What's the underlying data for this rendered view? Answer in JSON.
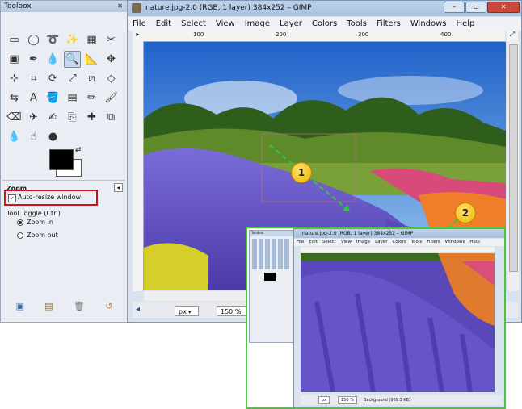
{
  "toolbox": {
    "title": "Toolbox",
    "close": "✕",
    "tools": [
      {
        "icon": "rect-select-icon",
        "glyph": "▭"
      },
      {
        "icon": "ellipse-select-icon",
        "glyph": "◯"
      },
      {
        "icon": "lasso-icon",
        "glyph": "➰"
      },
      {
        "icon": "fuzzy-select-icon",
        "glyph": "✨"
      },
      {
        "icon": "color-select-icon",
        "glyph": "▦"
      },
      {
        "icon": "scissors-select-icon",
        "glyph": "✂"
      },
      {
        "icon": "foreground-select-icon",
        "glyph": "▣"
      },
      {
        "icon": "paths-icon",
        "glyph": "✒"
      },
      {
        "icon": "color-picker-icon",
        "glyph": "💧"
      },
      {
        "icon": "zoom-icon",
        "glyph": "🔍"
      },
      {
        "icon": "measure-icon",
        "glyph": "📐"
      },
      {
        "icon": "move-icon",
        "glyph": "✥"
      },
      {
        "icon": "align-icon",
        "glyph": "⊹"
      },
      {
        "icon": "crop-icon",
        "glyph": "⌗"
      },
      {
        "icon": "rotate-icon",
        "glyph": "⟳"
      },
      {
        "icon": "scale-icon",
        "glyph": "⤢"
      },
      {
        "icon": "shear-icon",
        "glyph": "⧄"
      },
      {
        "icon": "perspective-icon",
        "glyph": "◇"
      },
      {
        "icon": "flip-icon",
        "glyph": "⇆"
      },
      {
        "icon": "text-icon",
        "glyph": "A"
      },
      {
        "icon": "bucket-fill-icon",
        "glyph": "🪣"
      },
      {
        "icon": "blend-icon",
        "glyph": "▤"
      },
      {
        "icon": "pencil-icon",
        "glyph": "✏"
      },
      {
        "icon": "paintbrush-icon",
        "glyph": "🖌"
      },
      {
        "icon": "eraser-icon",
        "glyph": "⌫"
      },
      {
        "icon": "airbrush-icon",
        "glyph": "✈"
      },
      {
        "icon": "ink-icon",
        "glyph": "✍"
      },
      {
        "icon": "clone-icon",
        "glyph": "⎘"
      },
      {
        "icon": "heal-icon",
        "glyph": "✚"
      },
      {
        "icon": "perspective-clone-icon",
        "glyph": "⧉"
      },
      {
        "icon": "blur-icon",
        "glyph": "💧"
      },
      {
        "icon": "smudge-icon",
        "glyph": "☝"
      },
      {
        "icon": "dodge-burn-icon",
        "glyph": "●"
      }
    ],
    "options_title": "Zoom",
    "auto_resize_label": "Auto-resize window",
    "checkmark": "✓",
    "tool_toggle_label": "Tool Toggle  (Ctrl)",
    "zoom_in_label": "Zoom in",
    "zoom_out_label": "Zoom out",
    "bottom_icons": [
      "save-icon",
      "restore-icon",
      "delete-icon",
      "reset-icon"
    ]
  },
  "gimp": {
    "title": "nature.jpg-2.0 (RGB, 1 layer) 384x252 – GIMP",
    "menus": [
      "File",
      "Edit",
      "Select",
      "View",
      "Image",
      "Layer",
      "Colors",
      "Tools",
      "Filters",
      "Windows",
      "Help"
    ],
    "ruler_ticks": [
      "100",
      "200",
      "300",
      "400"
    ],
    "unit": "px",
    "zoom": "150 %"
  },
  "callouts": [
    "1",
    "2"
  ],
  "inset": {
    "title": "nature.jpg-2.0 (RGB, 1 layer) 384x252 – GIMP",
    "menus": [
      "File",
      "Edit",
      "Select",
      "View",
      "Image",
      "Layer",
      "Colors",
      "Tools",
      "Filters",
      "Windows",
      "Help"
    ],
    "unit": "px",
    "zoom": "150 %",
    "status": "Background (969.3 KB)",
    "toolbox_title": "Toolbox"
  },
  "colors": {
    "highlight_red": "#d0121b",
    "callout_green": "#46c838",
    "callout_yellow": "#f0b400"
  }
}
